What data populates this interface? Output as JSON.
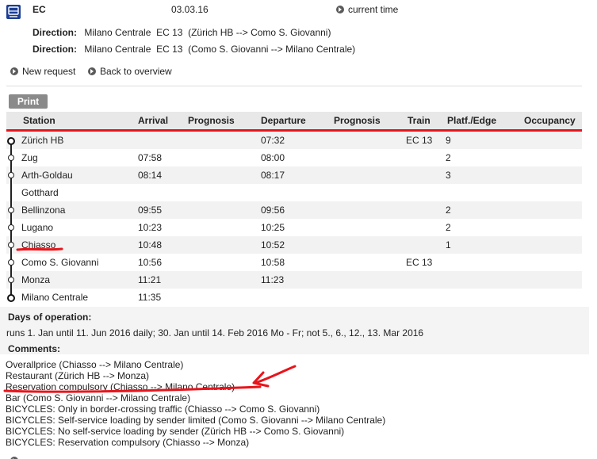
{
  "header": {
    "train_name": "EC",
    "date": "03.03.16",
    "current_time_label": "current time",
    "directions": [
      {
        "label": "Direction:",
        "value": "Milano Centrale  EC 13  (Zürich HB --> Como S. Giovanni)"
      },
      {
        "label": "Direction:",
        "value": "Milano Centrale  EC 13  (Como S. Giovanni --> Milano Centrale)"
      }
    ]
  },
  "nav": {
    "new_request": "New request",
    "back_to_overview": "Back to overview"
  },
  "print_label": "Print",
  "table": {
    "headers": [
      "Station",
      "Arrival",
      "Prognosis",
      "Departure",
      "Prognosis",
      "Train",
      "Platf./Edge",
      "Occupancy"
    ],
    "rows": [
      {
        "station": "Zürich HB",
        "arrival": "",
        "departure": "07:32",
        "train": "EC 13",
        "platform": "9"
      },
      {
        "station": "Zug",
        "arrival": "07:58",
        "departure": "08:00",
        "train": "",
        "platform": "2"
      },
      {
        "station": "Arth-Goldau",
        "arrival": "08:14",
        "departure": "08:17",
        "train": "",
        "platform": "3"
      },
      {
        "station": "Gotthard",
        "arrival": "",
        "departure": "",
        "train": "",
        "platform": ""
      },
      {
        "station": "Bellinzona",
        "arrival": "09:55",
        "departure": "09:56",
        "train": "",
        "platform": "2"
      },
      {
        "station": "Lugano",
        "arrival": "10:23",
        "departure": "10:25",
        "train": "",
        "platform": "2"
      },
      {
        "station": "Chiasso",
        "arrival": "10:48",
        "departure": "10:52",
        "train": "",
        "platform": "1"
      },
      {
        "station": "Como S. Giovanni",
        "arrival": "10:56",
        "departure": "10:58",
        "train": "EC 13",
        "platform": ""
      },
      {
        "station": "Monza",
        "arrival": "11:21",
        "departure": "11:23",
        "train": "",
        "platform": ""
      },
      {
        "station": "Milano Centrale",
        "arrival": "11:35",
        "departure": "",
        "train": "",
        "platform": ""
      }
    ]
  },
  "operation": {
    "title": "Days of operation:",
    "text": "runs 1. Jan until 11. Jun 2016 daily; 30. Jan until 14. Feb 2016 Mo - Fr; not 5., 6., 12., 13. Mar 2016"
  },
  "comments": {
    "title": "Comments:",
    "lines": [
      "Overallprice (Chiasso --> Milano Centrale)",
      "Restaurant (Zürich HB --> Monza)",
      "Reservation compulsory (Chiasso --> Milano Centrale)",
      "Bar (Como S. Giovanni --> Milano Centrale)",
      "BICYCLES: Only in border-crossing traffic (Chiasso --> Como S. Giovanni)",
      "BICYCLES: Self-service loading by sender limited (Como S. Giovanni --> Milano Centrale)",
      "BICYCLES: No self-service loading by sender (Zürich HB --> Como S. Giovanni)",
      "BICYCLES: Reservation compulsory (Chiasso --> Monza)"
    ]
  },
  "colors": {
    "accent_red": "#e8141b",
    "icon_blue": "#1c3f94",
    "header_grey": "#e8e8e8"
  }
}
